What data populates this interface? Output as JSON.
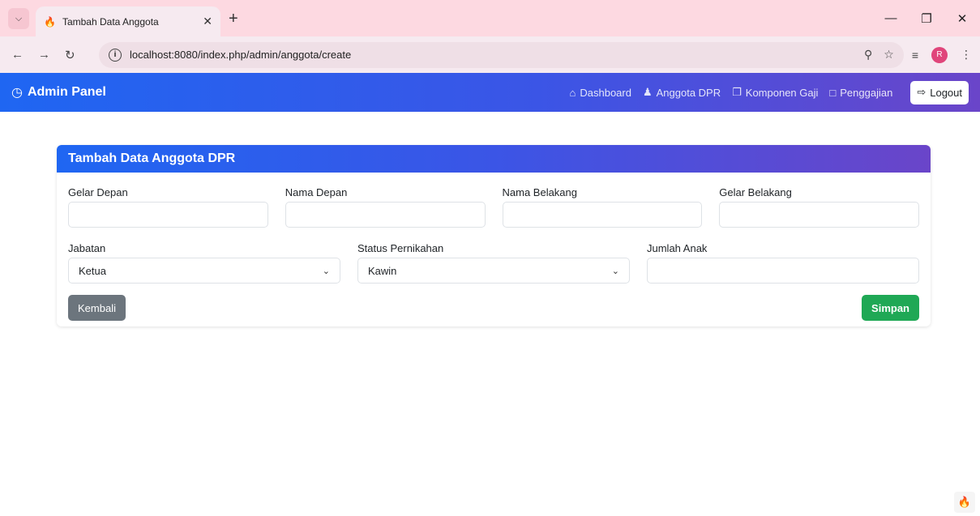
{
  "browser": {
    "tab_title": "Tambah Data Anggota",
    "url": "localhost:8080/index.php/admin/anggota/create",
    "avatar_letter": "R"
  },
  "navbar": {
    "brand": "Admin Panel",
    "links": [
      "Dashboard",
      "Anggota DPR",
      "Komponen Gaji",
      "Penggajian"
    ],
    "logout_label": "Logout"
  },
  "form": {
    "title": "Tambah Data Anggota DPR",
    "gelar_depan": {
      "label": "Gelar Depan",
      "value": ""
    },
    "nama_depan": {
      "label": "Nama Depan",
      "value": ""
    },
    "nama_belakang": {
      "label": "Nama Belakang",
      "value": ""
    },
    "gelar_belakang": {
      "label": "Gelar Belakang",
      "value": ""
    },
    "jabatan": {
      "label": "Jabatan",
      "value": "Ketua"
    },
    "status_pernikahan": {
      "label": "Status Pernikahan",
      "value": "Kawin"
    },
    "jumlah_anak": {
      "label": "Jumlah Anak",
      "value": ""
    },
    "back_label": "Kembali",
    "save_label": "Simpan"
  },
  "colors": {
    "navbar_start": "#1f66f2",
    "navbar_end": "#6a45c9",
    "save_button": "#1fa855",
    "back_button": "#6c757d"
  }
}
